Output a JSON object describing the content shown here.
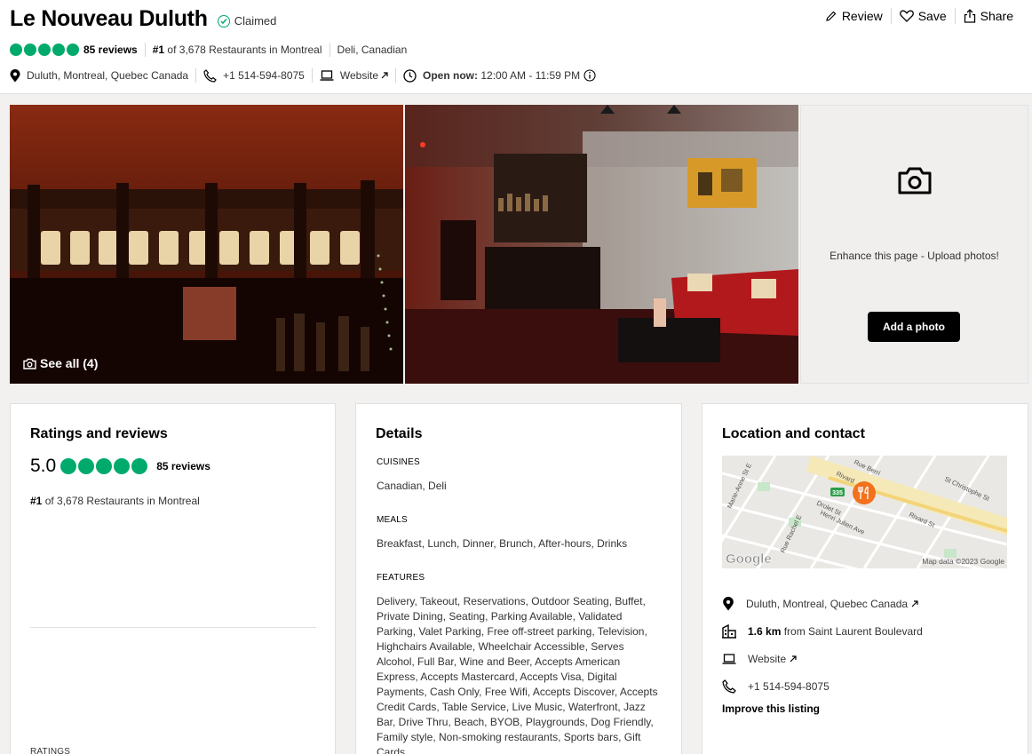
{
  "header": {
    "title": "Le Nouveau Duluth",
    "claimed": "Claimed",
    "actions": {
      "review": "Review",
      "save": "Save",
      "share": "Share"
    },
    "reviews_count": "85 reviews",
    "rank_prefix": "#1",
    "rank_rest": "of 3,678 Restaurants in Montreal",
    "cuisines": "Deli, Canadian",
    "address": "Duluth, Montreal, Quebec Canada",
    "phone": "+1 514-594-8075",
    "website": "Website",
    "open_label": "Open now:",
    "hours": "12:00 AM - 11:59 PM"
  },
  "gallery": {
    "see_all": "See all (4)",
    "upload_text": "Enhance this page - Upload photos!",
    "add_photo": "Add a photo"
  },
  "ratings_card": {
    "title": "Ratings and reviews",
    "score": "5.0",
    "reviews_count": "85 reviews",
    "rank_prefix": "#1",
    "rank_rest": "of 3,678 Restaurants in Montreal",
    "ratings_label": "RATINGS"
  },
  "details_card": {
    "title": "Details",
    "sections": [
      {
        "label": "CUISINES",
        "value": "Canadian, Deli"
      },
      {
        "label": "MEALS",
        "value": "Breakfast, Lunch, Dinner, Brunch, After-hours, Drinks"
      },
      {
        "label": "FEATURES",
        "value": "Delivery, Takeout, Reservations, Outdoor Seating, Buffet, Private Dining, Seating, Parking Available, Validated Parking, Valet Parking, Free off-street parking, Television, Highchairs Available, Wheelchair Accessible, Serves Alcohol, Full Bar, Wine and Beer, Accepts American Express, Accepts Mastercard, Accepts Visa, Digital Payments, Cash Only, Free Wifi, Accepts Discover, Accepts Credit Cards, Table Service, Live Music, Waterfront, Jazz Bar, Drive Thru, Beach, BYOB, Playgrounds, Dog Friendly, Family style, Non-smoking restaurants, Sports bars, Gift Cards"
      }
    ]
  },
  "location_card": {
    "title": "Location and contact",
    "map": {
      "streets": [
        "Marie-Anne St E",
        "Rue Berri",
        "Rivard",
        "St Christophe St",
        "Drolet St",
        "Henri Julien Ave",
        "Rue Rachel E",
        "Rivard St"
      ],
      "route_badge": "335",
      "google": "Google",
      "attribution": "Map data ©2023 Google"
    },
    "address": "Duluth, Montreal, Quebec Canada",
    "distance_bold": "1.6 km",
    "distance_rest": "from Saint Laurent Boulevard",
    "website": "Website",
    "phone": "+1 514-594-8075",
    "improve": "Improve this listing"
  },
  "colors": {
    "brand_green": "#00aa6c",
    "map_marker": "#f2711c",
    "button_bg": "#000000"
  }
}
